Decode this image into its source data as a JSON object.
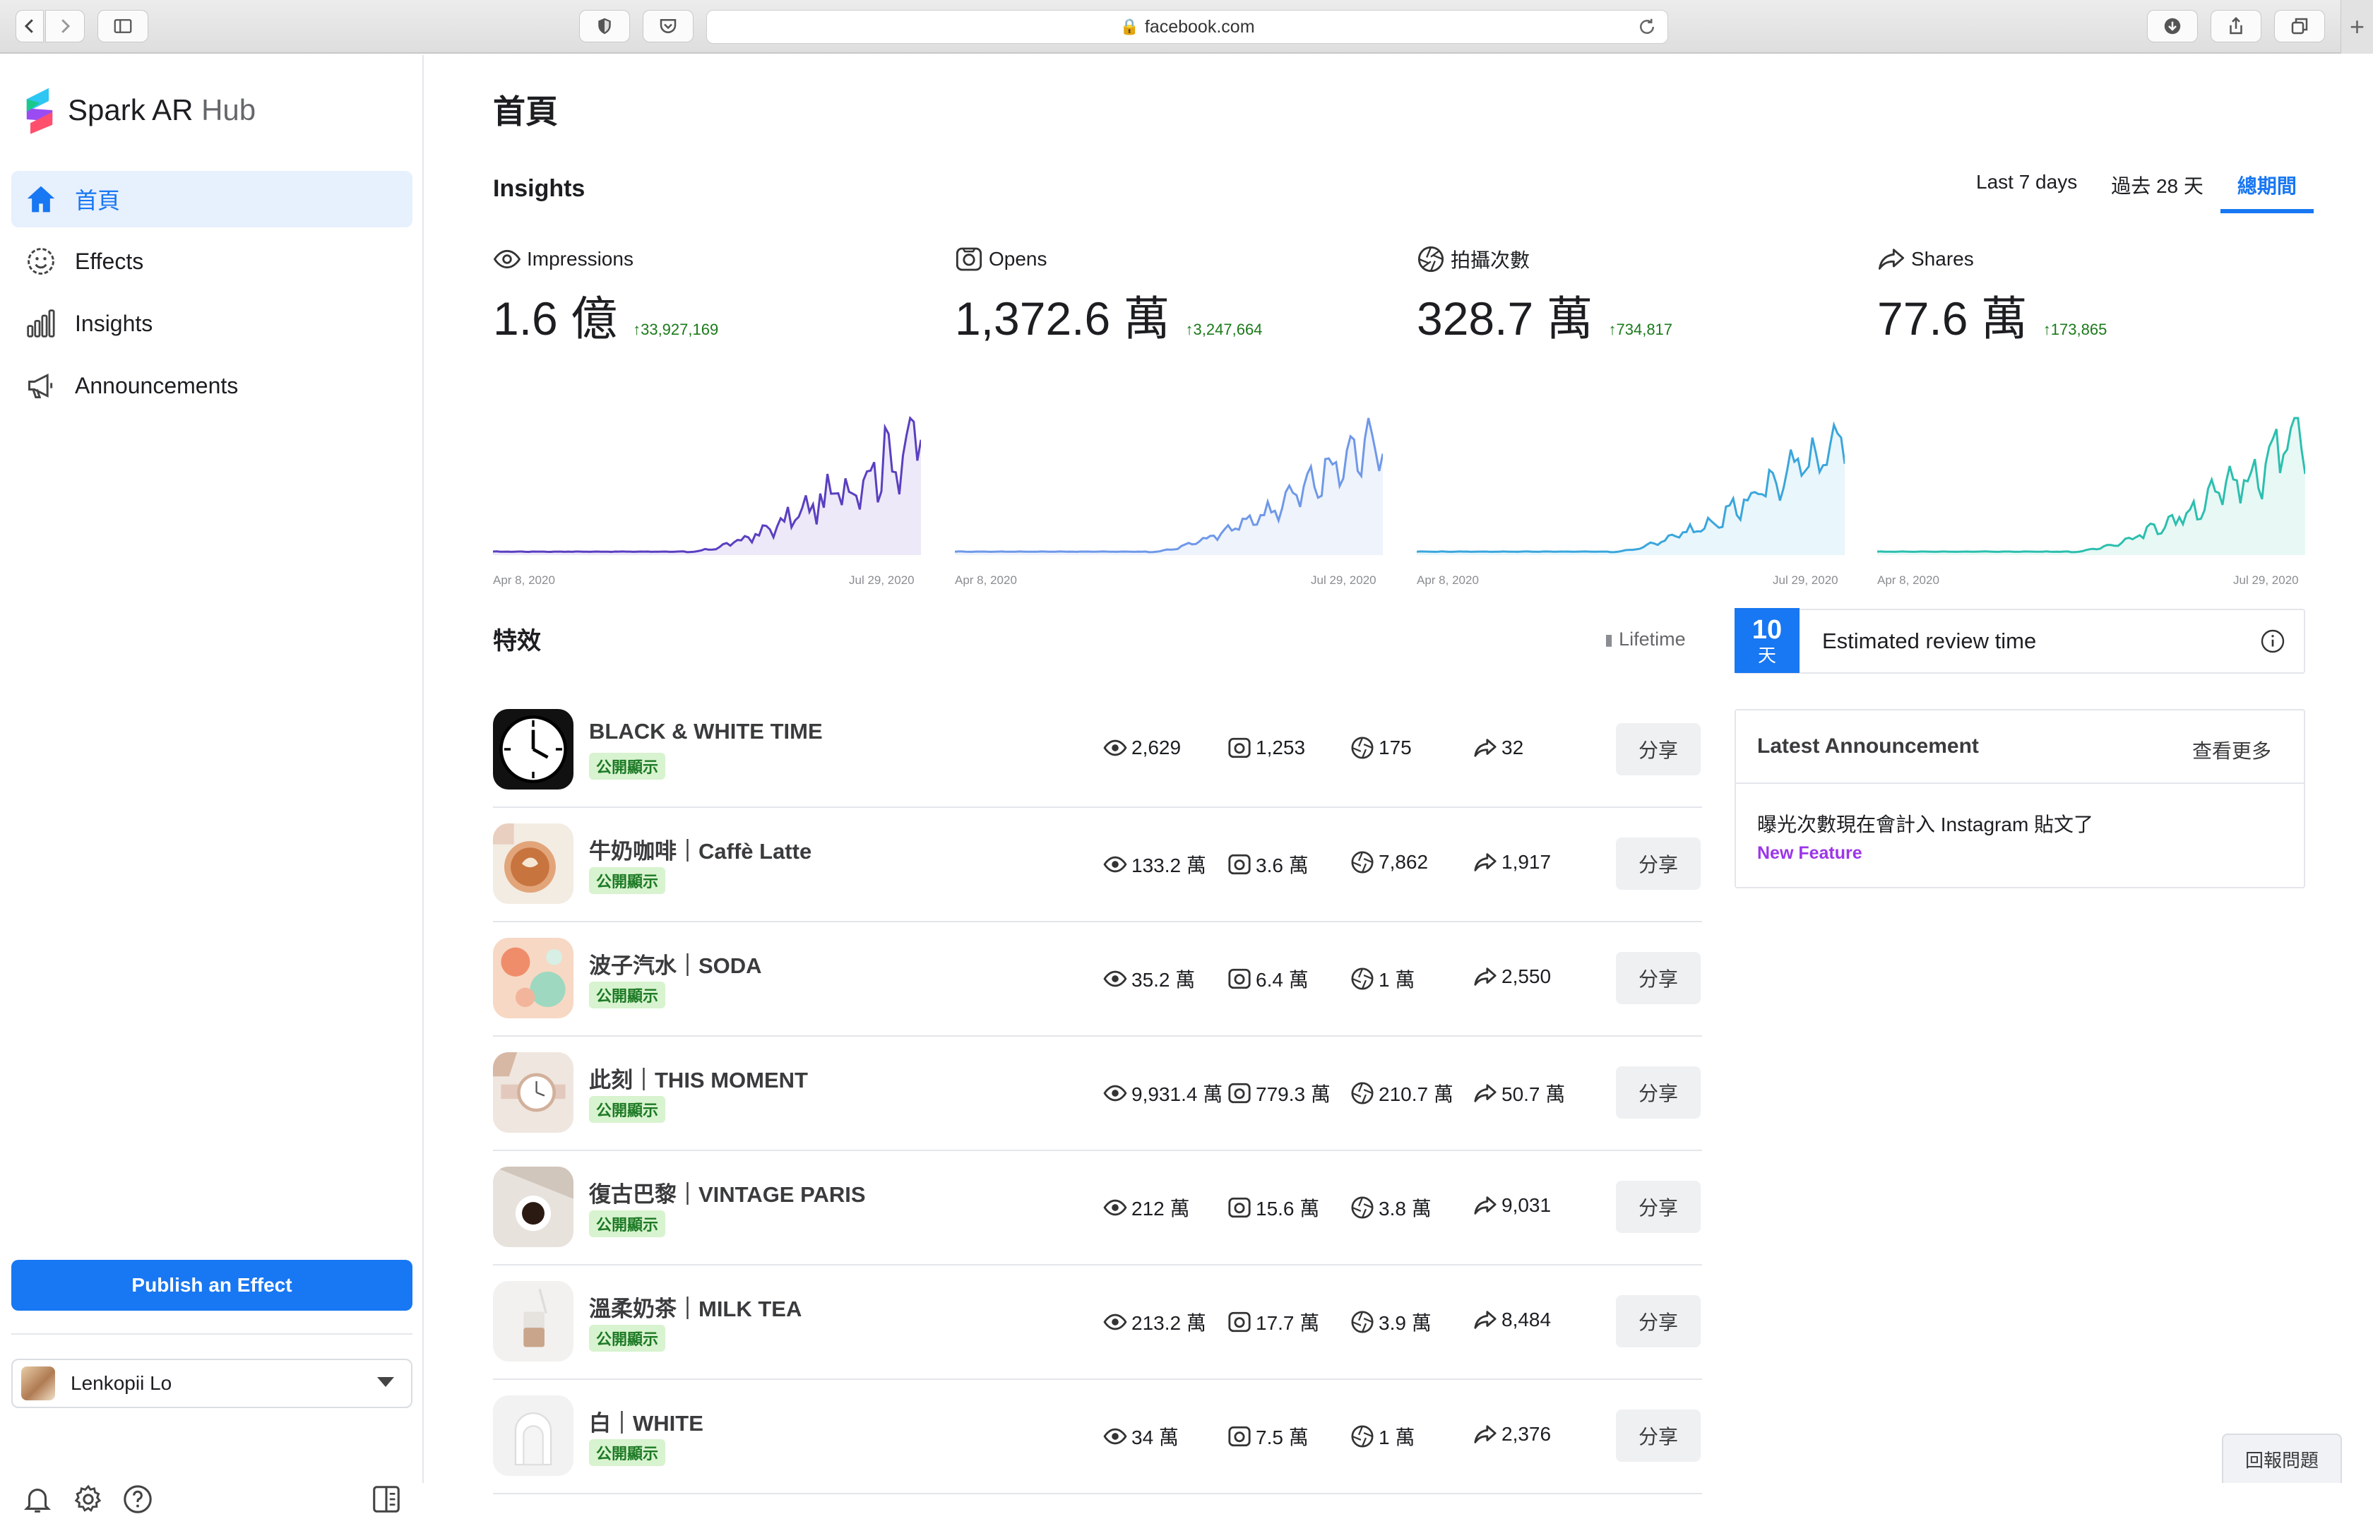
{
  "browser": {
    "url": "facebook.com"
  },
  "brand": {
    "name": "Spark AR",
    "suffix": "Hub"
  },
  "sidebar": {
    "items": [
      {
        "label": "首頁",
        "icon": "home-icon",
        "active": true
      },
      {
        "label": "Effects",
        "icon": "smiley-icon",
        "active": false
      },
      {
        "label": "Insights",
        "icon": "bar-chart-icon",
        "active": false
      },
      {
        "label": "Announcements",
        "icon": "megaphone-icon",
        "active": false
      }
    ],
    "publish_label": "Publish an Effect",
    "account_name": "Lenkopii Lo"
  },
  "main": {
    "page_title": "首頁",
    "insights_title": "Insights",
    "range_tabs": [
      {
        "label": "Last 7 days",
        "active": false
      },
      {
        "label": "過去 28 天",
        "active": false
      },
      {
        "label": "總期間",
        "active": true
      }
    ],
    "metrics": [
      {
        "label": "Impressions",
        "icon": "eye-icon",
        "value": "1.6 億",
        "delta": "↑33,927,169",
        "color": "#5a3fc0",
        "fill": "#ede9f8"
      },
      {
        "label": "Opens",
        "icon": "camera-icon",
        "value": "1,372.6 萬",
        "delta": "↑3,247,664",
        "color": "#6f98e8",
        "fill": "#eef3fc"
      },
      {
        "label": "拍攝次數",
        "icon": "shutter-icon",
        "value": "328.7 萬",
        "delta": "↑734,817",
        "color": "#3aa6dc",
        "fill": "#e9f6fb"
      },
      {
        "label": "Shares",
        "icon": "share-arrow-icon",
        "value": "77.6 萬",
        "delta": "↑173,865",
        "color": "#2bbfae",
        "fill": "#e8f8f5"
      }
    ],
    "spark_x_start": "Apr 8, 2020",
    "spark_x_end": "Jul 29, 2020",
    "effects_title": "特效",
    "lifetime_label": "Lifetime",
    "effects": [
      {
        "name": "BLACK & WHITE TIME",
        "badge": "公開顯示",
        "impressions": "2,629",
        "opens": "1,253",
        "captures": "175",
        "shares": "32",
        "thumb": "clock"
      },
      {
        "name": "牛奶咖啡｜Caffè Latte",
        "badge": "公開顯示",
        "impressions": "133.2 萬",
        "opens": "3.6 萬",
        "captures": "7,862",
        "shares": "1,917",
        "thumb": "latte"
      },
      {
        "name": "波子汽水｜SODA",
        "badge": "公開顯示",
        "impressions": "35.2 萬",
        "opens": "6.4 萬",
        "captures": "1 萬",
        "shares": "2,550",
        "thumb": "soda"
      },
      {
        "name": "此刻｜THIS MOMENT",
        "badge": "公開顯示",
        "impressions": "9,931.4 萬",
        "opens": "779.3 萬",
        "captures": "210.7 萬",
        "shares": "50.7 萬",
        "thumb": "watch"
      },
      {
        "name": "復古巴黎｜VINTAGE PARIS",
        "badge": "公開顯示",
        "impressions": "212 萬",
        "opens": "15.6 萬",
        "captures": "3.8 萬",
        "shares": "9,031",
        "thumb": "coffee"
      },
      {
        "name": "溫柔奶茶｜MILK TEA",
        "badge": "公開顯示",
        "impressions": "213.2 萬",
        "opens": "17.7 萬",
        "captures": "3.9 萬",
        "shares": "8,484",
        "thumb": "milktea"
      },
      {
        "name": "白｜WHITE",
        "badge": "公開顯示",
        "impressions": "34 萬",
        "opens": "7.5 萬",
        "captures": "1 萬",
        "shares": "2,376",
        "thumb": "white"
      }
    ],
    "share_label": "分享",
    "review": {
      "number": "10",
      "unit": "天",
      "label": "Estimated review time"
    },
    "announcement": {
      "title": "Latest Announcement",
      "more": "查看更多",
      "body": "曝光次數現在會計入 Instagram 貼文了",
      "tag": "New Feature"
    },
    "report_label": "回報問題"
  }
}
